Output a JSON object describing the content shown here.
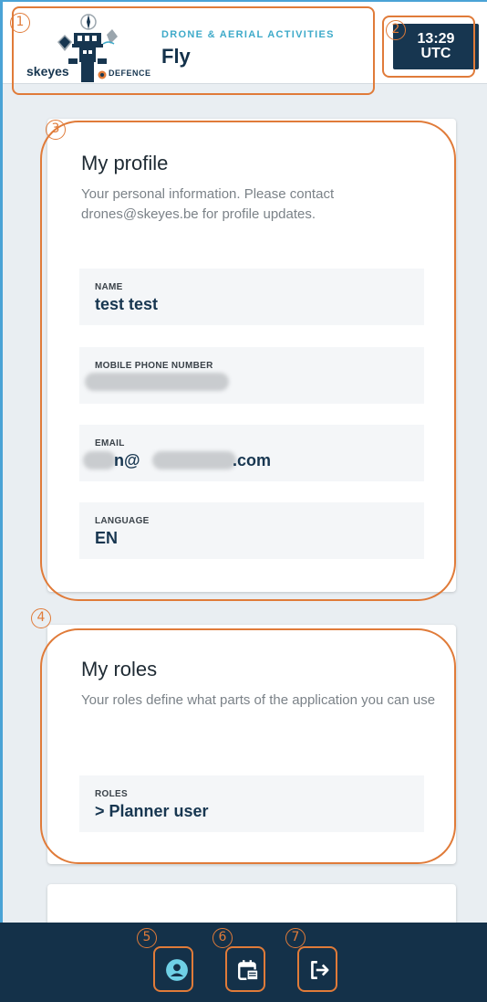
{
  "header": {
    "logo_text_left": "skeyes",
    "logo_text_right": "DEFENCE",
    "subtitle": "DRONE & AERIAL ACTIVITIES",
    "title": "Fly",
    "clock": {
      "time": "13:29",
      "zone": "UTC"
    }
  },
  "profile": {
    "title": "My profile",
    "description": "Your personal information. Please contact drones@skeyes.be for profile updates.",
    "fields": [
      {
        "label": "NAME",
        "value": "test test"
      },
      {
        "label": "MOBILE PHONE NUMBER",
        "value": ""
      },
      {
        "label": "EMAIL",
        "value_prefix": "n@",
        "value_suffix": ".com"
      },
      {
        "label": "LANGUAGE",
        "value": "EN"
      }
    ]
  },
  "roles": {
    "title": "My roles",
    "description": "Your roles define what parts of the application you can use",
    "field": {
      "label": "ROLES",
      "value": "> Planner user"
    }
  },
  "nav": {
    "items": [
      {
        "icon": "account-icon"
      },
      {
        "icon": "calendar-icon"
      },
      {
        "icon": "logout-icon"
      }
    ]
  },
  "annotations": [
    "1",
    "2",
    "3",
    "4",
    "5",
    "6",
    "7"
  ],
  "colors": {
    "accent": "#3eaac9",
    "navy": "#173650",
    "annotation": "#e07b39",
    "nav_icon": "#6fd0e6"
  }
}
